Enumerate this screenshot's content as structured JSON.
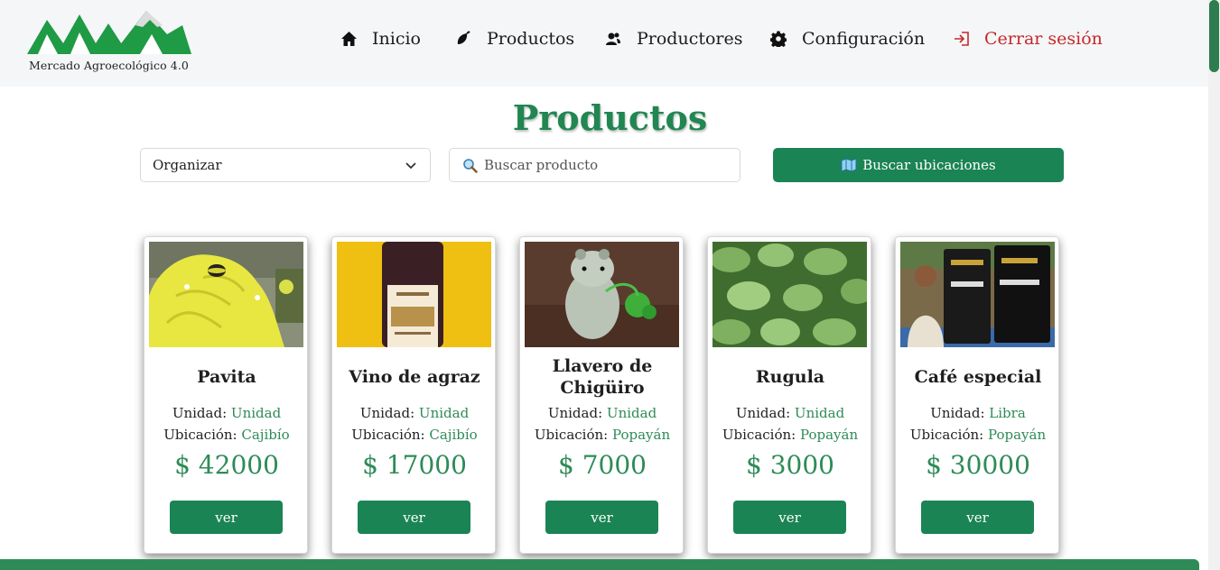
{
  "header": {
    "logo_text": "Mercado Agroecológico 4.0",
    "nav": [
      {
        "label": "Inicio",
        "icon": "home-icon"
      },
      {
        "label": "Productos",
        "icon": "seed-icon"
      },
      {
        "label": "Productores",
        "icon": "users-icon"
      },
      {
        "label": "Configuración",
        "icon": "gear-icon"
      },
      {
        "label": "Cerrar sesión",
        "icon": "logout-icon"
      }
    ]
  },
  "main": {
    "title": "Productos",
    "sort": {
      "value": "Organizar",
      "icon": "chevron-down-icon"
    },
    "search": {
      "placeholder": "Buscar producto",
      "icon": "search-icon"
    },
    "locations_button": {
      "label": "Buscar ubicaciones",
      "icon": "map-icon"
    }
  },
  "products": [
    {
      "name": "Pavita",
      "unit_label": "Unidad:",
      "unit": "Unidad",
      "location_label": "Ubicación:",
      "location": "Cajibío",
      "price": "$ 42000",
      "button": "ver"
    },
    {
      "name": "Vino de agraz",
      "unit_label": "Unidad:",
      "unit": "Unidad",
      "location_label": "Ubicación:",
      "location": "Cajibío",
      "price": "$ 17000",
      "button": "ver"
    },
    {
      "name": "Llavero de Chigüiro",
      "unit_label": "Unidad:",
      "unit": "Unidad",
      "location_label": "Ubicación:",
      "location": "Popayán",
      "price": "$ 7000",
      "button": "ver"
    },
    {
      "name": "Rugula",
      "unit_label": "Unidad:",
      "unit": "Unidad",
      "location_label": "Ubicación:",
      "location": "Popayán",
      "price": "$ 3000",
      "button": "ver"
    },
    {
      "name": "Café especial",
      "unit_label": "Unidad:",
      "unit": "Libra",
      "location_label": "Ubicación:",
      "location": "Popayán",
      "price": "$ 30000",
      "button": "ver"
    }
  ],
  "colors": {
    "brand": "#1b8454",
    "accent": "#2e8b57",
    "logout": "#c62828"
  }
}
